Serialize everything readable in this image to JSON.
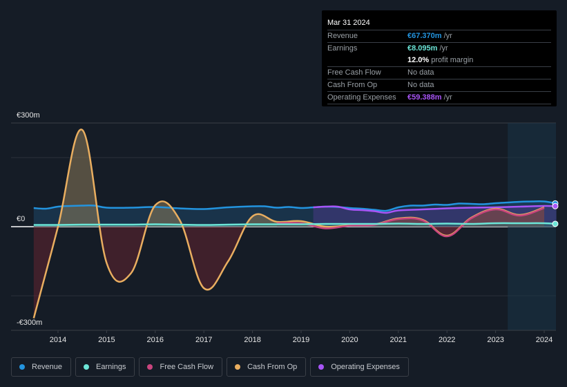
{
  "tooltip": {
    "date": "Mar 31 2024",
    "rows": [
      {
        "label": "Revenue",
        "value": "€67.370m",
        "suffix": " /yr",
        "color": "#2394df"
      },
      {
        "label": "Earnings",
        "value": "€8.095m",
        "suffix": " /yr",
        "color": "#6ce5d7"
      },
      {
        "label": "",
        "value": "12.0%",
        "suffix": " profit margin",
        "color": "#ffffff"
      },
      {
        "label": "Free Cash Flow",
        "value": "",
        "suffix": "No data",
        "color": "#9aa0a6"
      },
      {
        "label": "Cash From Op",
        "value": "",
        "suffix": "No data",
        "color": "#9aa0a6"
      },
      {
        "label": "Operating Expenses",
        "value": "€59.388m",
        "suffix": " /yr",
        "color": "#a855f7"
      }
    ]
  },
  "legend": [
    {
      "label": "Revenue",
      "color": "#2394df"
    },
    {
      "label": "Earnings",
      "color": "#6ce5d7"
    },
    {
      "label": "Free Cash Flow",
      "color": "#c9457e"
    },
    {
      "label": "Cash From Op",
      "color": "#e9ae60"
    },
    {
      "label": "Operating Expenses",
      "color": "#a855f7"
    }
  ],
  "chart_data": {
    "type": "area",
    "title": "",
    "xlabel": "",
    "ylabel": "",
    "ylim": [
      -300,
      300
    ],
    "xlim": [
      2013.0,
      2024.3
    ],
    "y_ticks": [
      {
        "value": 300,
        "label": "€300m"
      },
      {
        "value": 0,
        "label": "€0"
      },
      {
        "value": -300,
        "label": "-€300m"
      }
    ],
    "x_ticks": [
      2014,
      2015,
      2016,
      2017,
      2018,
      2019,
      2020,
      2021,
      2022,
      2023,
      2024
    ],
    "grid": true,
    "highlight_range": [
      2023.25,
      2024.25
    ],
    "series": [
      {
        "name": "Revenue",
        "color": "#2394df",
        "x": [
          2013.5,
          2013.75,
          2014,
          2014.25,
          2014.5,
          2014.75,
          2015,
          2015.5,
          2016,
          2016.5,
          2017,
          2017.5,
          2018,
          2018.25,
          2018.5,
          2018.75,
          2019,
          2019.25,
          2019.5,
          2019.75,
          2020,
          2020.25,
          2020.5,
          2020.75,
          2021,
          2021.25,
          2021.5,
          2021.75,
          2022,
          2022.25,
          2022.5,
          2022.75,
          2023,
          2023.25,
          2023.5,
          2023.75,
          2024,
          2024.25
        ],
        "values": [
          54,
          52,
          58,
          60,
          61,
          61,
          55,
          55,
          57,
          53,
          51,
          56,
          59,
          59,
          55,
          57,
          54,
          56,
          58,
          57,
          54,
          52,
          49,
          46,
          56,
          61,
          61,
          64,
          63,
          67,
          66,
          65,
          68,
          70,
          72,
          73,
          73,
          67.37
        ]
      },
      {
        "name": "Earnings",
        "color": "#6ce5d7",
        "x": [
          2013.5,
          2014,
          2014.5,
          2015,
          2015.5,
          2016,
          2016.5,
          2017,
          2017.5,
          2018,
          2018.5,
          2019,
          2019.5,
          2020,
          2020.5,
          2021,
          2021.5,
          2022,
          2022.5,
          2023,
          2023.5,
          2024,
          2024.25
        ],
        "values": [
          5,
          5,
          6,
          6,
          6,
          7,
          6,
          5,
          6,
          7,
          7,
          7,
          8,
          8,
          8,
          9,
          8,
          9,
          8,
          10,
          10,
          10,
          8.095
        ]
      },
      {
        "name": "Free Cash Flow",
        "color": "#c9457e",
        "x": [
          2018.5,
          2019,
          2019.5,
          2020,
          2020.5,
          2021,
          2021.5,
          2022,
          2022.5,
          2023,
          2023.5,
          2024
        ],
        "values": [
          10,
          10,
          -5,
          3,
          5,
          22,
          18,
          -28,
          24,
          50,
          32,
          54
        ]
      },
      {
        "name": "Cash From Op",
        "color": "#e9ae60",
        "x": [
          2013.5,
          2014,
          2014.5,
          2015,
          2015.5,
          2016,
          2016.5,
          2017,
          2017.5,
          2018,
          2018.5,
          2019,
          2019.5,
          2020,
          2020.5,
          2021,
          2021.5,
          2022,
          2022.5,
          2023,
          2023.5,
          2024
        ],
        "values": [
          -265,
          0,
          280,
          -105,
          -135,
          62,
          20,
          -178,
          -100,
          30,
          14,
          16,
          0,
          4,
          6,
          24,
          20,
          -26,
          26,
          52,
          34,
          56
        ]
      },
      {
        "name": "Operating Expenses",
        "color": "#a855f7",
        "x": [
          2019.25,
          2019.5,
          2019.75,
          2020,
          2020.25,
          2020.5,
          2020.75,
          2021,
          2021.5,
          2022,
          2022.5,
          2023,
          2023.5,
          2024,
          2024.25
        ],
        "values": [
          56,
          58,
          58,
          50,
          48,
          45,
          40,
          47,
          50,
          53,
          55,
          56,
          58,
          60,
          59.388
        ]
      }
    ]
  }
}
